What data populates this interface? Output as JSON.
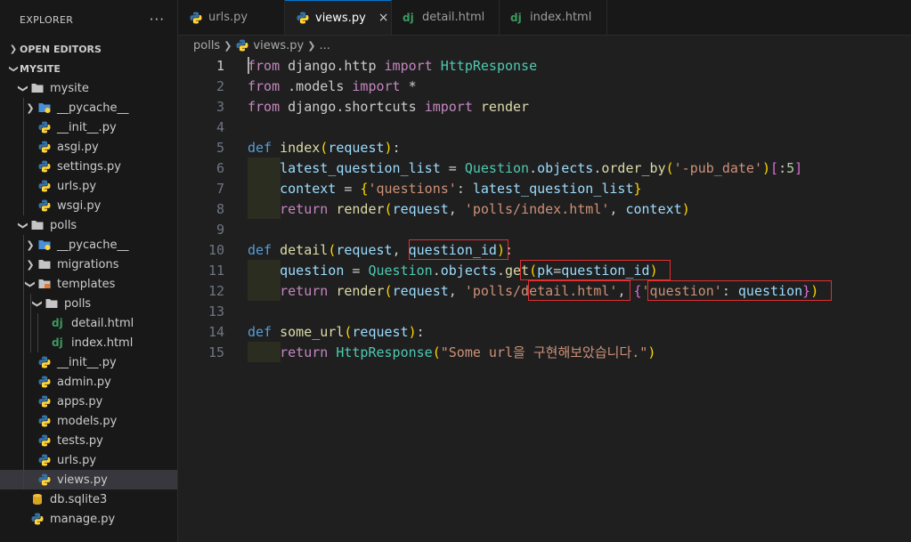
{
  "explorer": {
    "title": "EXPLORER",
    "more": "···",
    "open_editors": "OPEN EDITORS",
    "workspace": "MYSITE"
  },
  "tree": [
    {
      "label": "mysite",
      "depth": 1,
      "kind": "folder",
      "open": true
    },
    {
      "label": "__pycache__",
      "depth": 2,
      "kind": "pycache",
      "open": false
    },
    {
      "label": "__init__.py",
      "depth": 2,
      "kind": "py"
    },
    {
      "label": "asgi.py",
      "depth": 2,
      "kind": "py"
    },
    {
      "label": "settings.py",
      "depth": 2,
      "kind": "py"
    },
    {
      "label": "urls.py",
      "depth": 2,
      "kind": "py"
    },
    {
      "label": "wsgi.py",
      "depth": 2,
      "kind": "py"
    },
    {
      "label": "polls",
      "depth": 1,
      "kind": "folder",
      "open": true
    },
    {
      "label": "__pycache__",
      "depth": 2,
      "kind": "pycache",
      "open": false
    },
    {
      "label": "migrations",
      "depth": 2,
      "kind": "folder",
      "open": false
    },
    {
      "label": "templates",
      "depth": 2,
      "kind": "templates",
      "open": true
    },
    {
      "label": "polls",
      "depth": 3,
      "kind": "folder",
      "open": true
    },
    {
      "label": "detail.html",
      "depth": 4,
      "kind": "dj"
    },
    {
      "label": "index.html",
      "depth": 4,
      "kind": "dj"
    },
    {
      "label": "__init__.py",
      "depth": 2,
      "kind": "py"
    },
    {
      "label": "admin.py",
      "depth": 2,
      "kind": "py"
    },
    {
      "label": "apps.py",
      "depth": 2,
      "kind": "py"
    },
    {
      "label": "models.py",
      "depth": 2,
      "kind": "py"
    },
    {
      "label": "tests.py",
      "depth": 2,
      "kind": "py"
    },
    {
      "label": "urls.py",
      "depth": 2,
      "kind": "py"
    },
    {
      "label": "views.py",
      "depth": 2,
      "kind": "py",
      "selected": true
    },
    {
      "label": "db.sqlite3",
      "depth": 1,
      "kind": "db"
    },
    {
      "label": "manage.py",
      "depth": 1,
      "kind": "py"
    }
  ],
  "tabs": [
    {
      "label": "urls.py",
      "kind": "py",
      "active": false
    },
    {
      "label": "views.py",
      "kind": "py",
      "active": true,
      "close": "×"
    },
    {
      "label": "detail.html",
      "kind": "dj",
      "active": false
    },
    {
      "label": "index.html",
      "kind": "dj",
      "active": false
    }
  ],
  "breadcrumb": {
    "folder": "polls",
    "file": "views.py",
    "rest": "..."
  },
  "colors": {
    "accent": "#0078d4",
    "highlight_box": "#e03030",
    "python_blue": "#3572a5",
    "python_yellow": "#ffd43b",
    "django_green": "#3c9a5f"
  },
  "code": [
    {
      "n": "1",
      "current": true,
      "indent": false,
      "tokens": [
        [
          "kw2",
          "from"
        ],
        [
          "pl",
          " "
        ],
        [
          "pl",
          "django.http"
        ],
        [
          "pl",
          " "
        ],
        [
          "kw2",
          "import"
        ],
        [
          "pl",
          " "
        ],
        [
          "cls",
          "HttpResponse"
        ]
      ]
    },
    {
      "n": "2",
      "indent": false,
      "tokens": [
        [
          "kw2",
          "from"
        ],
        [
          "pl",
          " .models "
        ],
        [
          "kw2",
          "import"
        ],
        [
          "pl",
          " *"
        ]
      ]
    },
    {
      "n": "3",
      "indent": false,
      "tokens": [
        [
          "kw2",
          "from"
        ],
        [
          "pl",
          " django.shortcuts "
        ],
        [
          "kw2",
          "import"
        ],
        [
          "pl",
          " "
        ],
        [
          "fn",
          "render"
        ]
      ]
    },
    {
      "n": "4",
      "indent": false,
      "tokens": []
    },
    {
      "n": "5",
      "indent": false,
      "tokens": [
        [
          "kw",
          "def"
        ],
        [
          "pl",
          " "
        ],
        [
          "fn",
          "index"
        ],
        [
          "br1",
          "("
        ],
        [
          "var",
          "request"
        ],
        [
          "br1",
          ")"
        ],
        [
          "pl",
          ":"
        ]
      ]
    },
    {
      "n": "6",
      "indent": true,
      "tokens": [
        [
          "pl",
          "    "
        ],
        [
          "var",
          "latest_question_list"
        ],
        [
          "pl",
          " = "
        ],
        [
          "cls",
          "Question"
        ],
        [
          "pl",
          "."
        ],
        [
          "var",
          "objects"
        ],
        [
          "pl",
          "."
        ],
        [
          "fn",
          "order_by"
        ],
        [
          "br1",
          "("
        ],
        [
          "str",
          "'-pub_date'"
        ],
        [
          "br1",
          ")"
        ],
        [
          "br2",
          "["
        ],
        [
          "pl",
          ":"
        ],
        [
          "num",
          "5"
        ],
        [
          "br2",
          "]"
        ]
      ]
    },
    {
      "n": "7",
      "indent": true,
      "tokens": [
        [
          "pl",
          "    "
        ],
        [
          "var",
          "context"
        ],
        [
          "pl",
          " = "
        ],
        [
          "br1",
          "{"
        ],
        [
          "str",
          "'questions'"
        ],
        [
          "pl",
          ": "
        ],
        [
          "var",
          "latest_question_list"
        ],
        [
          "br1",
          "}"
        ]
      ]
    },
    {
      "n": "8",
      "indent": true,
      "tokens": [
        [
          "pl",
          "    "
        ],
        [
          "kw2",
          "return"
        ],
        [
          "pl",
          " "
        ],
        [
          "fn",
          "render"
        ],
        [
          "br1",
          "("
        ],
        [
          "var",
          "request"
        ],
        [
          "pl",
          ", "
        ],
        [
          "str",
          "'polls/index.html'"
        ],
        [
          "pl",
          ", "
        ],
        [
          "var",
          "context"
        ],
        [
          "br1",
          ")"
        ]
      ]
    },
    {
      "n": "9",
      "indent": false,
      "tokens": []
    },
    {
      "n": "10",
      "indent": false,
      "tokens": [
        [
          "kw",
          "def"
        ],
        [
          "pl",
          " "
        ],
        [
          "fn",
          "detail"
        ],
        [
          "br1",
          "("
        ],
        [
          "var",
          "request"
        ],
        [
          "pl",
          ", "
        ],
        [
          "var",
          "question_id"
        ],
        [
          "br1",
          ")"
        ],
        [
          "pl",
          ":"
        ]
      ]
    },
    {
      "n": "11",
      "indent": true,
      "tokens": [
        [
          "pl",
          "    "
        ],
        [
          "var",
          "question"
        ],
        [
          "pl",
          " = "
        ],
        [
          "cls",
          "Question"
        ],
        [
          "pl",
          "."
        ],
        [
          "var",
          "objects"
        ],
        [
          "pl",
          "."
        ],
        [
          "fn",
          "get"
        ],
        [
          "br1",
          "("
        ],
        [
          "var",
          "pk"
        ],
        [
          "pl",
          "="
        ],
        [
          "var",
          "question_id"
        ],
        [
          "br1",
          ")"
        ]
      ]
    },
    {
      "n": "12",
      "indent": true,
      "tokens": [
        [
          "pl",
          "    "
        ],
        [
          "kw2",
          "return"
        ],
        [
          "pl",
          " "
        ],
        [
          "fn",
          "render"
        ],
        [
          "br1",
          "("
        ],
        [
          "var",
          "request"
        ],
        [
          "pl",
          ", "
        ],
        [
          "str",
          "'polls/detail.html'"
        ],
        [
          "pl",
          ", "
        ],
        [
          "br2",
          "{"
        ],
        [
          "str",
          "'question'"
        ],
        [
          "pl",
          ": "
        ],
        [
          "var",
          "question"
        ],
        [
          "br2",
          "}"
        ],
        [
          "br1",
          ")"
        ]
      ]
    },
    {
      "n": "13",
      "indent": false,
      "tokens": []
    },
    {
      "n": "14",
      "indent": false,
      "tokens": [
        [
          "kw",
          "def"
        ],
        [
          "pl",
          " "
        ],
        [
          "fn",
          "some_url"
        ],
        [
          "br1",
          "("
        ],
        [
          "var",
          "request"
        ],
        [
          "br1",
          ")"
        ],
        [
          "pl",
          ":"
        ]
      ]
    },
    {
      "n": "15",
      "indent": true,
      "tokens": [
        [
          "pl",
          "    "
        ],
        [
          "kw2",
          "return"
        ],
        [
          "pl",
          " "
        ],
        [
          "cls",
          "HttpResponse"
        ],
        [
          "br1",
          "("
        ],
        [
          "str",
          "\"Some url을 구현해보았습니다.\""
        ],
        [
          "br1",
          ")"
        ]
      ]
    }
  ]
}
